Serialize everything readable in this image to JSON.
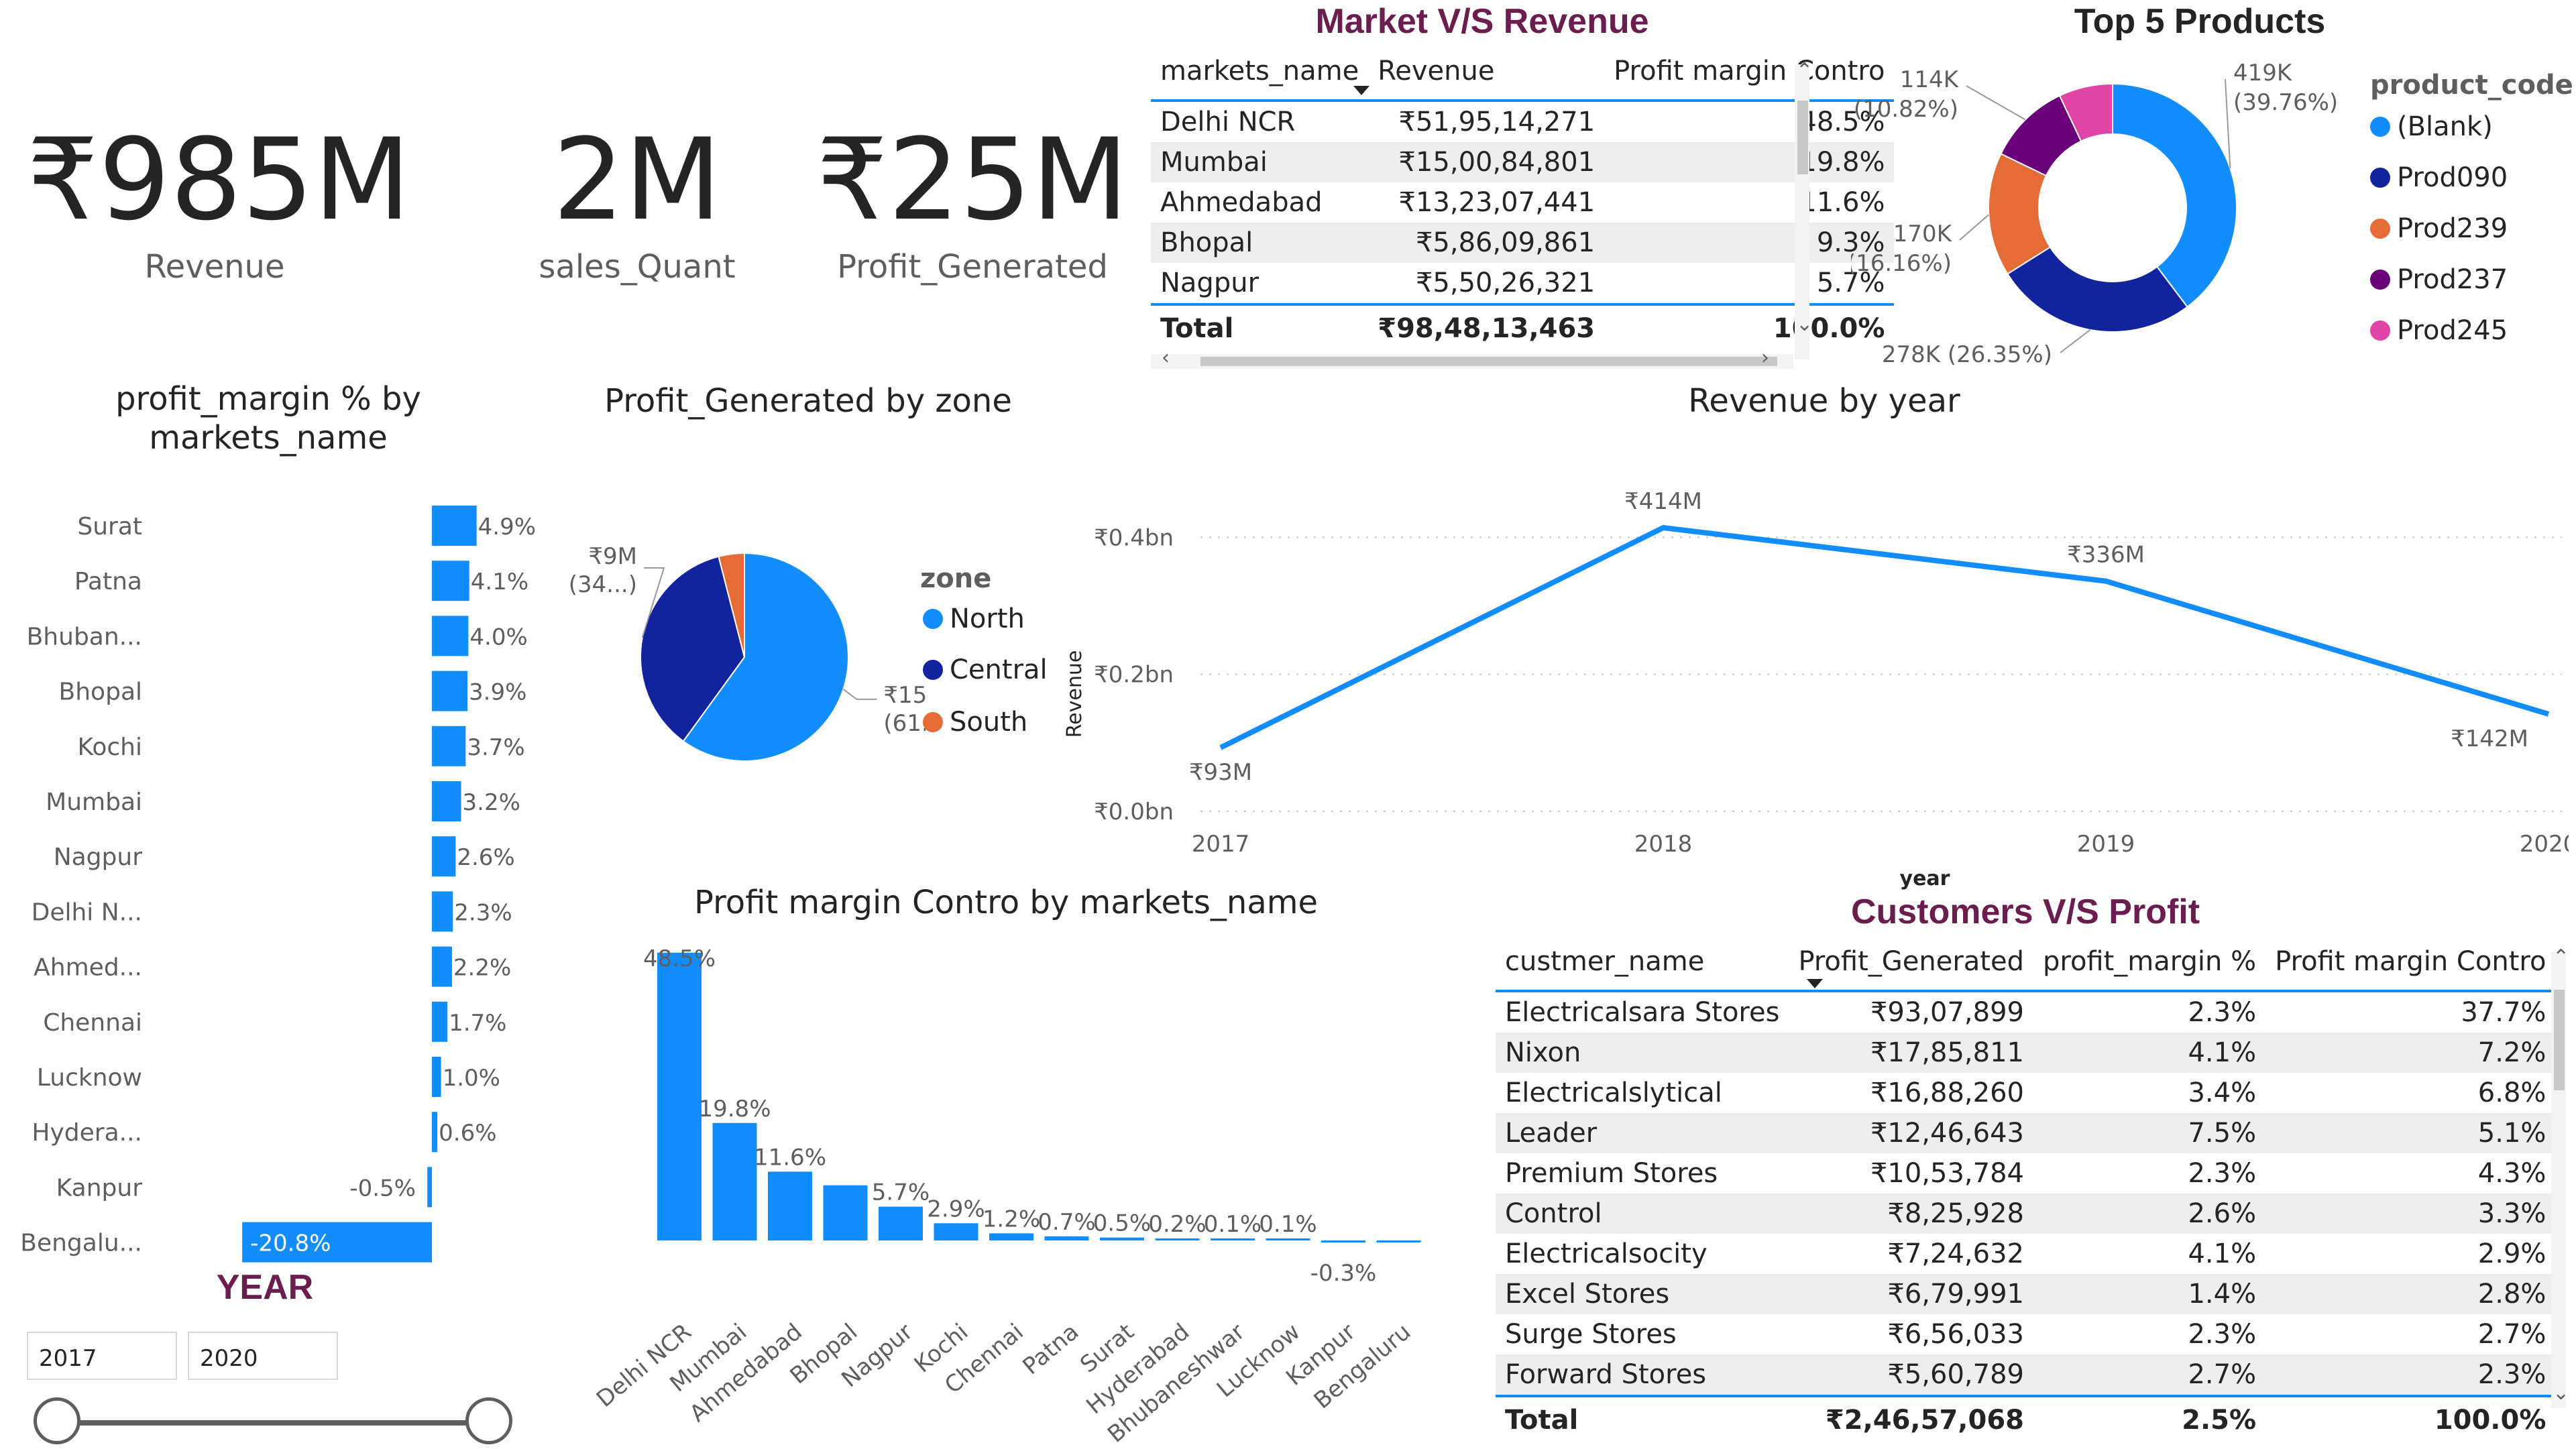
{
  "kpis": {
    "revenue": {
      "value": "₹985M",
      "label": "Revenue"
    },
    "sales_quant": {
      "value": "2M",
      "label": "sales_Quant"
    },
    "profit": {
      "value": "₹25M",
      "label": "Profit_Generated"
    }
  },
  "market_table": {
    "title": "Market V/S Revenue",
    "headers": [
      "markets_name",
      "Revenue",
      "Profit margin Contro"
    ],
    "rows": [
      [
        "Delhi NCR",
        "₹51,95,14,271",
        "48.5%"
      ],
      [
        "Mumbai",
        "₹15,00,84,801",
        "19.8%"
      ],
      [
        "Ahmedabad",
        "₹13,23,07,441",
        "11.6%"
      ],
      [
        "Bhopal",
        "₹5,86,09,861",
        "9.3%"
      ],
      [
        "Nagpur",
        "₹5,50,26,321",
        "5.7%"
      ]
    ],
    "total": [
      "Total",
      "₹98,48,13,463",
      "100.0%"
    ]
  },
  "customer_table": {
    "title": "Customers V/S Profit",
    "headers": [
      "custmer_name",
      "Profit_Generated",
      "profit_margin %",
      "Profit margin Contro"
    ],
    "rows": [
      [
        "Electricalsara Stores",
        "₹93,07,899",
        "2.3%",
        "37.7%"
      ],
      [
        "Nixon",
        "₹17,85,811",
        "4.1%",
        "7.2%"
      ],
      [
        "Electricalslytical",
        "₹16,88,260",
        "3.4%",
        "6.8%"
      ],
      [
        "Leader",
        "₹12,46,643",
        "7.5%",
        "5.1%"
      ],
      [
        "Premium Stores",
        "₹10,53,784",
        "2.3%",
        "4.3%"
      ],
      [
        "Control",
        "₹8,25,928",
        "2.6%",
        "3.3%"
      ],
      [
        "Electricalsocity",
        "₹7,24,632",
        "4.1%",
        "2.9%"
      ],
      [
        "Excel Stores",
        "₹6,79,991",
        "1.4%",
        "2.8%"
      ],
      [
        "Surge Stores",
        "₹6,56,033",
        "2.3%",
        "2.7%"
      ],
      [
        "Forward Stores",
        "₹5,60,789",
        "2.7%",
        "2.3%"
      ]
    ],
    "total": [
      "Total",
      "₹2,46,57,068",
      "2.5%",
      "100.0%"
    ]
  },
  "year_slicer": {
    "title": "YEAR",
    "start": "2017",
    "end": "2020"
  },
  "colors": {
    "accent": "#118dff",
    "dark_blue": "#12239e",
    "orange": "#e66c37",
    "purple": "#6b007b",
    "pink": "#e044a7",
    "maroon": "#6b1d4f"
  },
  "chart_data": [
    {
      "id": "profit_margin_by_market",
      "type": "bar",
      "orientation": "horizontal",
      "title": "profit_margin % by markets_name",
      "categories": [
        "Surat",
        "Patna",
        "Bhuban...",
        "Bhopal",
        "Kochi",
        "Mumbai",
        "Nagpur",
        "Delhi N...",
        "Ahmed...",
        "Chennai",
        "Lucknow",
        "Hydera...",
        "Kanpur",
        "Bengalu..."
      ],
      "values": [
        4.9,
        4.1,
        4.0,
        3.9,
        3.7,
        3.2,
        2.6,
        2.3,
        2.2,
        1.7,
        1.0,
        0.6,
        -0.5,
        -20.8
      ],
      "labels": [
        "4.9%",
        "4.1%",
        "4.0%",
        "3.9%",
        "3.7%",
        "3.2%",
        "2.6%",
        "2.3%",
        "2.2%",
        "1.7%",
        "1.0%",
        "0.6%",
        "-0.5%",
        "-20.8%"
      ]
    },
    {
      "id": "profit_by_zone",
      "type": "pie",
      "title": "Profit_Generated by zone",
      "legend_title": "zone",
      "legend": [
        "North",
        "Central",
        "South"
      ],
      "values": [
        15,
        9,
        1
      ],
      "colors": [
        "#118dff",
        "#12239e",
        "#e66c37"
      ],
      "slice_labels": [
        {
          "value": "₹15M",
          "pct": "(61.14%)"
        },
        {
          "value": "₹9M",
          "pct": "(34...)"
        }
      ]
    },
    {
      "id": "revenue_by_year",
      "type": "line",
      "title": "Revenue by year",
      "xlabel": "year",
      "ylabel": "Revenue",
      "x": [
        "2017",
        "2018",
        "2019",
        "2020"
      ],
      "values": [
        93,
        414,
        336,
        142
      ],
      "point_labels": [
        "₹93M",
        "₹414M",
        "₹336M",
        "₹142M"
      ],
      "y_ticks": [
        "₹0.0bn",
        "₹0.2bn",
        "₹0.4bn"
      ],
      "y_tick_values": [
        0,
        200,
        400
      ],
      "ylim": [
        0,
        460
      ]
    },
    {
      "id": "top5_products",
      "type": "pie",
      "subtype": "donut",
      "title": "Top 5 Products",
      "legend_title": "product_code",
      "legend": [
        "(Blank)",
        "Prod090",
        "Prod239",
        "Prod237",
        "Prod245"
      ],
      "values": [
        419,
        278,
        170,
        114,
        74
      ],
      "colors": [
        "#118dff",
        "#12239e",
        "#e66c37",
        "#6b007b",
        "#e044a7"
      ],
      "slice_labels": [
        {
          "value": "419K",
          "pct": "(39.76%)"
        },
        {
          "value": "278K",
          "pct": "(26.35%)"
        },
        {
          "value": "170K",
          "pct": "(16.16%)"
        },
        {
          "value": "114K",
          "pct": "(10.82%)"
        }
      ]
    },
    {
      "id": "profit_contro_by_market",
      "type": "bar",
      "orientation": "vertical",
      "title": "Profit margin Contro by markets_name",
      "categories": [
        "Delhi NCR",
        "Mumbai",
        "Ahmedabad",
        "Bhopal",
        "Nagpur",
        "Kochi",
        "Chennai",
        "Patna",
        "Surat",
        "Hyderabad",
        "Bhubaneshwar",
        "Lucknow",
        "Kanpur",
        "Bengaluru"
      ],
      "values": [
        48.5,
        19.8,
        11.6,
        9.3,
        5.7,
        2.9,
        1.2,
        0.7,
        0.5,
        0.2,
        0.1,
        0.1,
        -0.3,
        -0.3
      ],
      "labels": [
        "48.5%",
        "19.8%",
        "11.6%",
        "",
        "5.7%",
        "2.9%",
        "1.2%",
        "0.7%",
        "0.5%",
        "0.2%",
        "0.1%",
        "0.1%",
        "-0.3%",
        ""
      ]
    }
  ]
}
